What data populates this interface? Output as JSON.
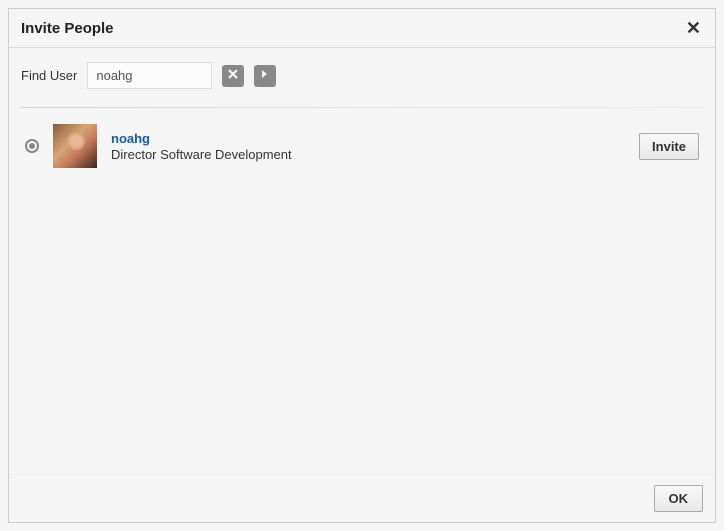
{
  "dialog": {
    "title": "Invite People"
  },
  "find": {
    "label": "Find User",
    "value": "noahg"
  },
  "results": [
    {
      "username": "noahg",
      "title": "Director Software Development",
      "invite_label": "Invite",
      "selected": true
    }
  ],
  "footer": {
    "ok_label": "OK"
  }
}
